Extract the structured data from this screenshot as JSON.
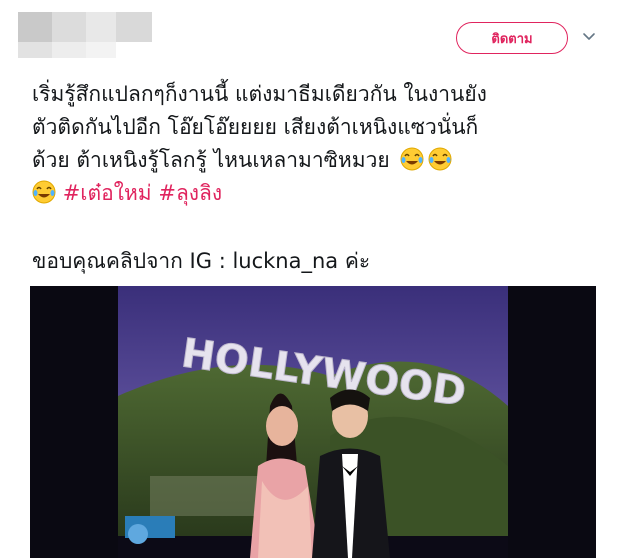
{
  "header": {
    "follow_label": "ติดตาม"
  },
  "tweet": {
    "lines": [
      "เริ่มรู้สึกแปลกๆก็งานนี้ แต่งมาธีมเดียวกัน ในงานยัง",
      "ตัวติดกันไปอีก โอ๊ยโอ๊ยยยย เสียงต้าเหนิงแซวนั่นก็",
      "ด้วย ต้าเหนิงรู้โลกรู้ ไหนเหลามาซิหมวย"
    ],
    "hashtags": [
      "#เต๋อใหม่",
      "#ลุงลิง"
    ],
    "credit": "ขอบคุณคลิปจาก IG : luckna_na ค่ะ"
  },
  "video": {
    "sign_text": "HOLLYWOOD"
  },
  "colors": {
    "accent": "#e0245e",
    "text": "#14171a",
    "muted": "#657786"
  },
  "icons": {
    "follow_chevron": "chevron-down-icon",
    "emoji": "face-with-tears-of-joy-icon"
  }
}
